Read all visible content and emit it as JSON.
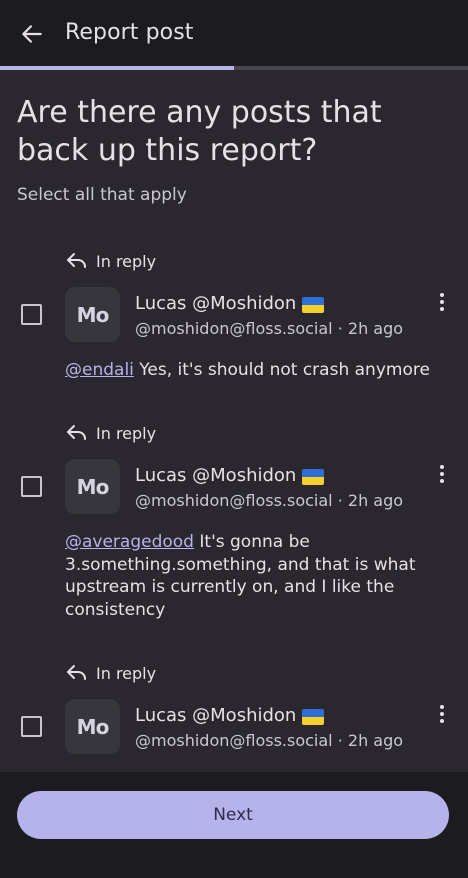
{
  "appbar": {
    "title": "Report post",
    "back_icon": "arrow-left-icon"
  },
  "progress": {
    "fraction": 0.5,
    "fill_color": "#b6b2ea",
    "track_color": "#47464f"
  },
  "main": {
    "heading": "Are there any posts that back up this report?",
    "subheading": "Select all that apply"
  },
  "posts": [
    {
      "reply_label": "In reply",
      "avatar_text": "Mo",
      "name": "Lucas @Moshidon",
      "handle_time": "@moshidon@floss.social · 2h ago",
      "mention": "@endali",
      "text": " Yes, it's should not crash anymore"
    },
    {
      "reply_label": "In reply",
      "avatar_text": "Mo",
      "name": "Lucas @Moshidon",
      "handle_time": "@moshidon@floss.social · 2h ago",
      "mention": "@averagedood",
      "text": " It's gonna be 3.something.something, and that is what upstream is currently on, and I like the consistency"
    },
    {
      "reply_label": "In reply",
      "avatar_text": "Mo",
      "name": "Lucas @Moshidon",
      "handle_time": "@moshidon@floss.social · 2h ago",
      "mention": "",
      "text": ""
    }
  ],
  "footer": {
    "next_label": "Next"
  },
  "colors": {
    "accent": "#b6b2ea",
    "background": "#1c1b20",
    "surface": "#2a282e"
  }
}
